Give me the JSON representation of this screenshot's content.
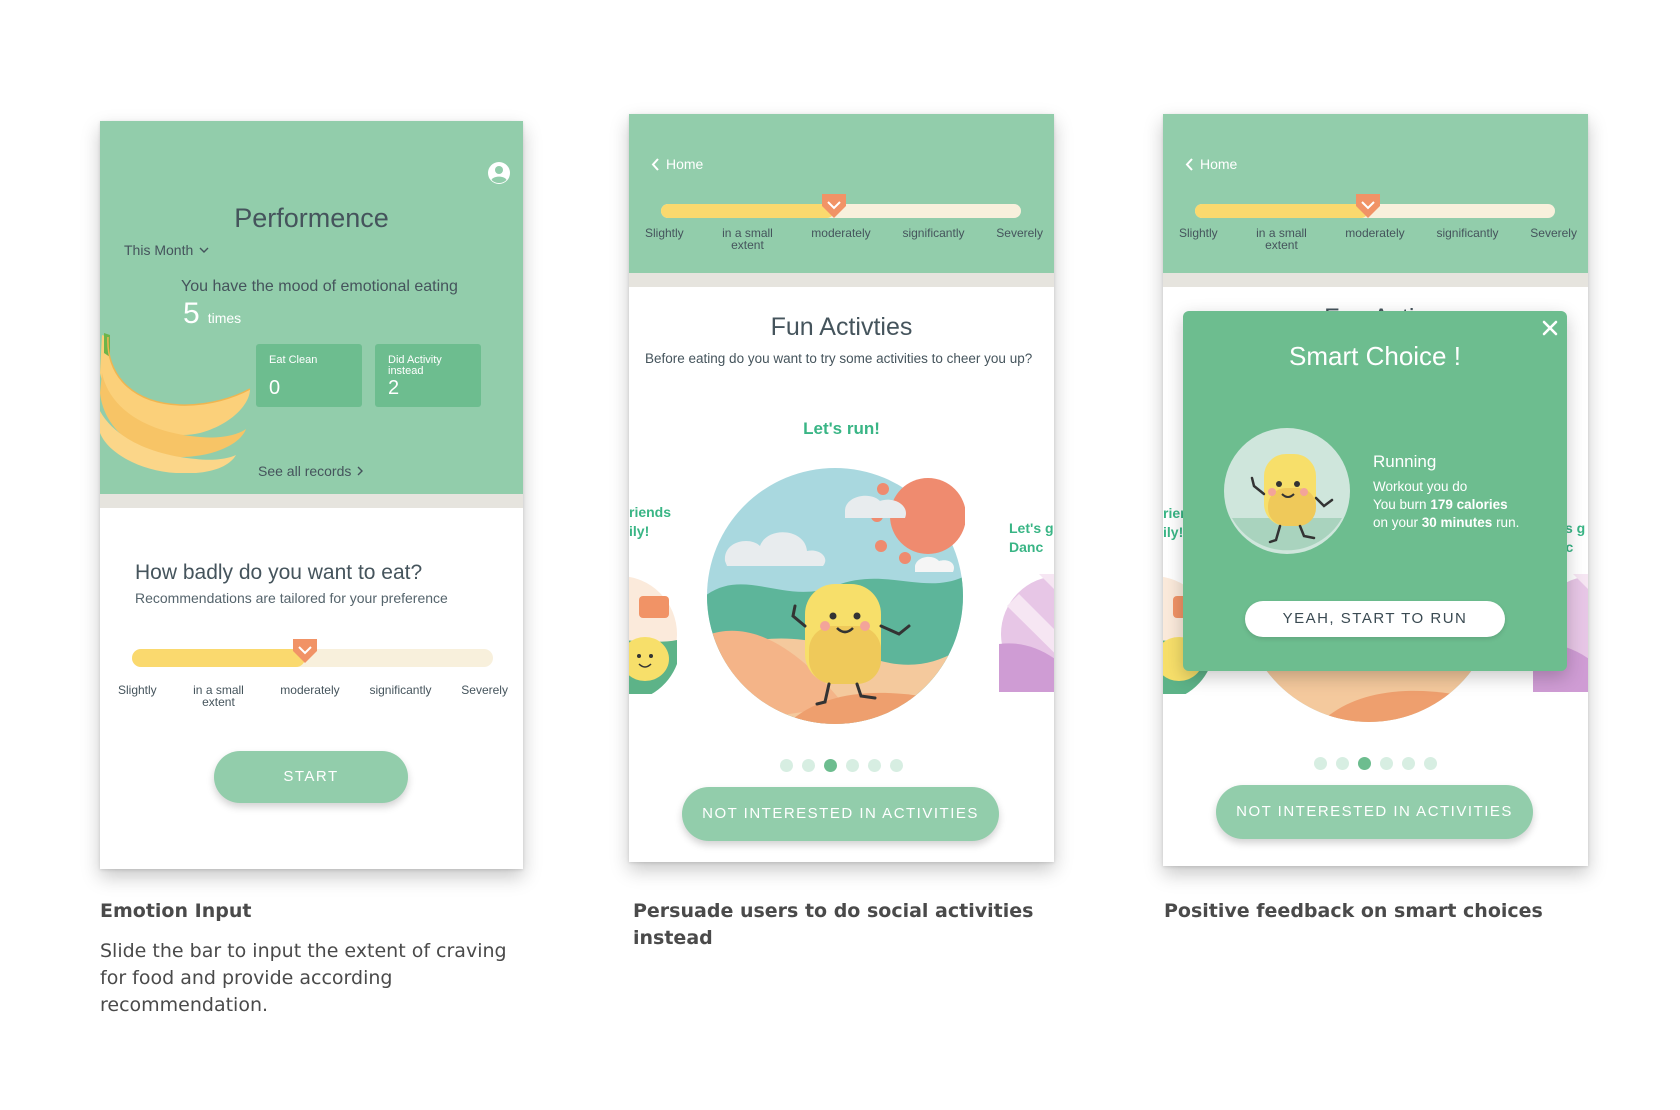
{
  "scale_labels": [
    "Slightly",
    "in a small extent",
    "moderately",
    "significantly",
    "Severely"
  ],
  "slider_level": 0.48,
  "screen1": {
    "title": "Performence",
    "period": "This Month",
    "mood_text": "You have the mood of emotional eating",
    "count": "5",
    "count_unit": "times",
    "eat_clean_label": "Eat Clean",
    "eat_clean_value": "0",
    "did_activity_label": "Did Activity instead",
    "did_activity_value": "2",
    "see_all": "See all records",
    "question": "How badly do you want to eat?",
    "question_sub": "Recommendations are tailored for your preference",
    "start_button": "START"
  },
  "screen2": {
    "back_label": "Home",
    "title": "Fun Activties",
    "subtitle": "Before eating do you want to try some activities to cheer you up?",
    "activity_label": "Let's run!",
    "side_left_label": "riends\nily!",
    "side_right_label": "Let's g\nDanc",
    "carousel_count": 6,
    "carousel_active": 3,
    "not_interested_button": "NOT INTERESTED IN ACTIVITIES"
  },
  "screen3": {
    "back_label": "Home",
    "hidden_title": "Fun Activ",
    "side_left_label": "rier\nily!",
    "side_right_label": "t's g\nnc",
    "modal_title": "Smart Choice !",
    "activity_name": "Running",
    "line1": "Workout you do",
    "line2_pre": "You burn ",
    "line2_bold": "179 calories",
    "line3_pre": "on your ",
    "line3_bold": "30 minutes",
    "line3_post": " run.",
    "run_button": "YEAH, START TO RUN",
    "not_interested_button": "NOT INTERESTED IN ACTIVITIES"
  },
  "captions": {
    "c1_title": "Emotion Input",
    "c1_body": "Slide the bar to input the extent of craving for food and provide according recommendation.",
    "c2_title": "Persuade users to do social activities instead",
    "c3_title": "Positive feedback on smart choices"
  },
  "colors": {
    "header_green": "#92cdab",
    "accent_green": "#6dbd8f",
    "text_green": "#39b585",
    "slider_fill": "#fad96e",
    "slider_track": "#f8f0dc",
    "thumb": "#f19366"
  }
}
